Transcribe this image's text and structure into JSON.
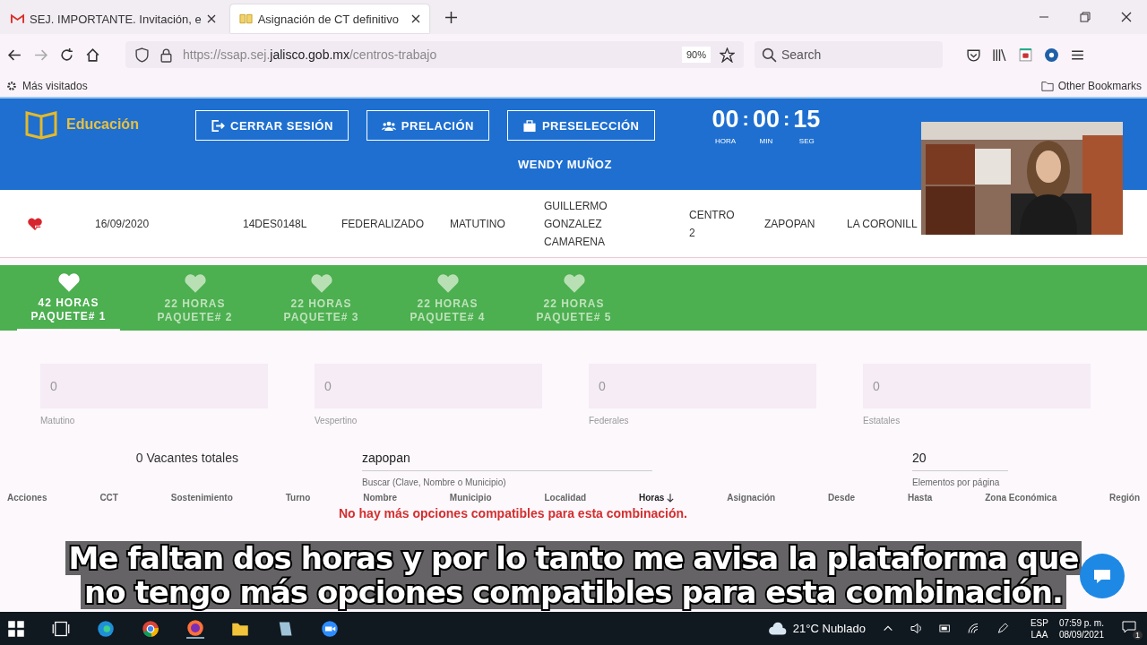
{
  "browser": {
    "tabs": [
      {
        "title": "SEJ. IMPORTANTE. Invitación, e",
        "selected": false,
        "kind": "mail"
      },
      {
        "title": "Asignación de CT definitivo",
        "selected": true,
        "kind": "book"
      }
    ],
    "url": "https://ssap.sej.**jalisco.gob.mx**/centros-trabajo",
    "zoom": "90%",
    "search_placeholder": "Search",
    "bookmark": "Más visitados",
    "other_bookmarks": "Other Bookmarks"
  },
  "header": {
    "brand": "Educación",
    "buttons": [
      {
        "label": "CERRAR SESIÓN",
        "kind": "logout"
      },
      {
        "label": "PRELACIÓN",
        "kind": "people"
      },
      {
        "label": "PRESELECCIÓN",
        "kind": "case"
      }
    ],
    "timer": [
      {
        "value": "00",
        "unit": "HORA"
      },
      {
        "value": "00",
        "unit": "MIN"
      },
      {
        "value": "15",
        "unit": "SEG"
      }
    ],
    "timer_separator": ":",
    "user": "WENDY MUÑOZ"
  },
  "row": {
    "cells": [
      "16/09/2020",
      "14DES0148L",
      "FEDERALIZADO",
      "MATUTINO",
      "GUILLERMO GONZALEZ CAMARENA",
      "CENTRO 2",
      "ZAPOPAN",
      "LA CORONILL"
    ]
  },
  "packages": [
    {
      "hours": "42 HORAS",
      "label": "PAQUETE# 1",
      "selected": true
    },
    {
      "hours": "22 HORAS",
      "label": "PAQUETE# 2",
      "selected": false
    },
    {
      "hours": "22 HORAS",
      "label": "PAQUETE# 3",
      "selected": false
    },
    {
      "hours": "22 HORAS",
      "label": "PAQUETE# 4",
      "selected": false
    },
    {
      "hours": "22 HORAS",
      "label": "PAQUETE# 5",
      "selected": false
    }
  ],
  "counters": [
    {
      "value": "0",
      "label": "Matutino"
    },
    {
      "value": "0",
      "label": "Vespertino"
    },
    {
      "value": "0",
      "label": "Federales"
    },
    {
      "value": "0",
      "label": "Estatales"
    }
  ],
  "vacantes": "0 Vacantes totales",
  "search": {
    "value": "zapopan",
    "hint": "Buscar (Clave, Nombre o Municipio)"
  },
  "per_page": {
    "value": "20",
    "hint": "Elementos por página"
  },
  "columns": [
    {
      "label": "Acciones",
      "sorted": false
    },
    {
      "label": "CCT",
      "sorted": false
    },
    {
      "label": "Sostenimiento",
      "sorted": false
    },
    {
      "label": "Turno",
      "sorted": false
    },
    {
      "label": "Nombre",
      "sorted": false
    },
    {
      "label": "Municipio",
      "sorted": false
    },
    {
      "label": "Localidad",
      "sorted": false
    },
    {
      "label": "Horas",
      "sorted": true
    },
    {
      "label": "Asignación",
      "sorted": false
    },
    {
      "label": "Desde",
      "sorted": false
    },
    {
      "label": "Hasta",
      "sorted": false
    },
    {
      "label": "Zona Económica",
      "sorted": false
    },
    {
      "label": "Región",
      "sorted": false
    }
  ],
  "message": "No hay más opciones compatibles para esta combinación.",
  "subtitles": [
    "Me faltan dos horas y por lo tanto me avisa la plataforma que",
    "no tengo más opciones compatibles para esta combinación."
  ],
  "taskbar": {
    "weather": "21°C Nublado",
    "lang": [
      "ESP",
      "LAA"
    ],
    "time": "07:59 p. m.",
    "date": "08/09/2021",
    "notifications": "1"
  }
}
